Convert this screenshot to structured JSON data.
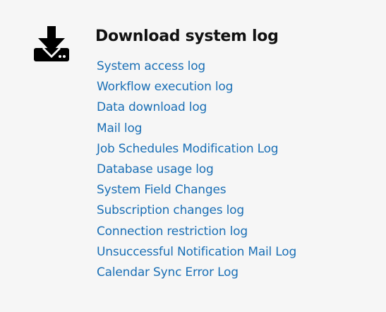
{
  "section": {
    "title": "Download system log",
    "icon": "download-tray-icon",
    "links": [
      {
        "label": "System access log",
        "name": "link-system-access-log"
      },
      {
        "label": "Workflow execution log",
        "name": "link-workflow-execution-log"
      },
      {
        "label": "Data download log",
        "name": "link-data-download-log"
      },
      {
        "label": "Mail log",
        "name": "link-mail-log"
      },
      {
        "label": "Job Schedules Modification Log",
        "name": "link-job-schedules-modification-log"
      },
      {
        "label": "Database usage log",
        "name": "link-database-usage-log"
      },
      {
        "label": "System Field Changes",
        "name": "link-system-field-changes"
      },
      {
        "label": "Subscription changes log",
        "name": "link-subscription-changes-log"
      },
      {
        "label": "Connection restriction log",
        "name": "link-connection-restriction-log"
      },
      {
        "label": "Unsuccessful Notification Mail Log",
        "name": "link-unsuccessful-notification-mail-log"
      },
      {
        "label": "Calendar Sync Error Log",
        "name": "link-calendar-sync-error-log"
      }
    ]
  },
  "colors": {
    "background": "#f6f6f6",
    "link": "#1a6fb5",
    "title": "#111111",
    "icon": "#000000"
  }
}
